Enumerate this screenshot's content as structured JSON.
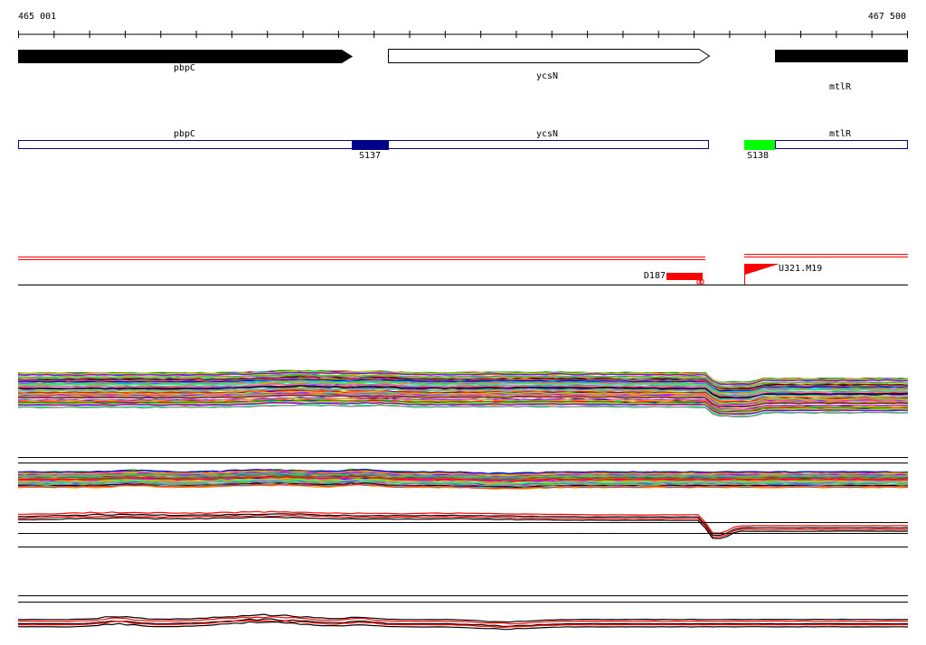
{
  "ruler": {
    "start_label": "465 001",
    "end_label": "467 500"
  },
  "genes": [
    {
      "name": "pbpC",
      "strand": "+",
      "style": "filled"
    },
    {
      "name": "ycsN",
      "strand": "+",
      "style": "outline"
    },
    {
      "name": "mtlR",
      "strand": "+",
      "style": "filled"
    }
  ],
  "annotation_track": {
    "genes": [
      "pbpC",
      "ycsN",
      "mtlR"
    ],
    "segments": [
      {
        "label": "S137",
        "color": "#00008b"
      },
      {
        "label": "S138",
        "color": "#00ff00"
      }
    ]
  },
  "features": [
    {
      "label": "D187",
      "color": "#ff0000",
      "kind": "bar"
    },
    {
      "label": "U321.M19",
      "color": "#ff0000",
      "kind": "flag"
    }
  ],
  "colors": {
    "track_line": "#00008b",
    "accent": "#ff0000",
    "ink": "#000000"
  }
}
